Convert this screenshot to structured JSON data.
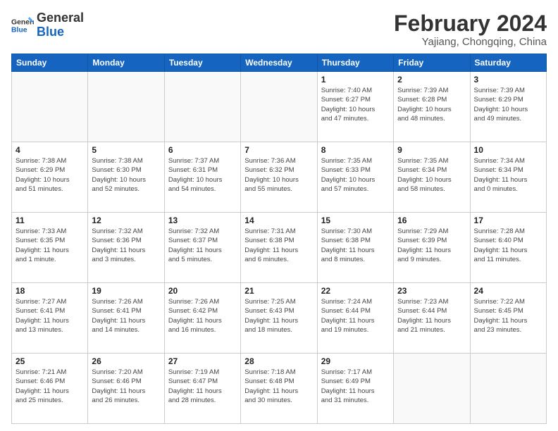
{
  "logo": {
    "line1": "General",
    "line2": "Blue"
  },
  "title": "February 2024",
  "subtitle": "Yajiang, Chongqing, China",
  "days_of_week": [
    "Sunday",
    "Monday",
    "Tuesday",
    "Wednesday",
    "Thursday",
    "Friday",
    "Saturday"
  ],
  "weeks": [
    [
      {
        "day": "",
        "info": ""
      },
      {
        "day": "",
        "info": ""
      },
      {
        "day": "",
        "info": ""
      },
      {
        "day": "",
        "info": ""
      },
      {
        "day": "1",
        "info": "Sunrise: 7:40 AM\nSunset: 6:27 PM\nDaylight: 10 hours\nand 47 minutes."
      },
      {
        "day": "2",
        "info": "Sunrise: 7:39 AM\nSunset: 6:28 PM\nDaylight: 10 hours\nand 48 minutes."
      },
      {
        "day": "3",
        "info": "Sunrise: 7:39 AM\nSunset: 6:29 PM\nDaylight: 10 hours\nand 49 minutes."
      }
    ],
    [
      {
        "day": "4",
        "info": "Sunrise: 7:38 AM\nSunset: 6:29 PM\nDaylight: 10 hours\nand 51 minutes."
      },
      {
        "day": "5",
        "info": "Sunrise: 7:38 AM\nSunset: 6:30 PM\nDaylight: 10 hours\nand 52 minutes."
      },
      {
        "day": "6",
        "info": "Sunrise: 7:37 AM\nSunset: 6:31 PM\nDaylight: 10 hours\nand 54 minutes."
      },
      {
        "day": "7",
        "info": "Sunrise: 7:36 AM\nSunset: 6:32 PM\nDaylight: 10 hours\nand 55 minutes."
      },
      {
        "day": "8",
        "info": "Sunrise: 7:35 AM\nSunset: 6:33 PM\nDaylight: 10 hours\nand 57 minutes."
      },
      {
        "day": "9",
        "info": "Sunrise: 7:35 AM\nSunset: 6:34 PM\nDaylight: 10 hours\nand 58 minutes."
      },
      {
        "day": "10",
        "info": "Sunrise: 7:34 AM\nSunset: 6:34 PM\nDaylight: 11 hours\nand 0 minutes."
      }
    ],
    [
      {
        "day": "11",
        "info": "Sunrise: 7:33 AM\nSunset: 6:35 PM\nDaylight: 11 hours\nand 1 minute."
      },
      {
        "day": "12",
        "info": "Sunrise: 7:32 AM\nSunset: 6:36 PM\nDaylight: 11 hours\nand 3 minutes."
      },
      {
        "day": "13",
        "info": "Sunrise: 7:32 AM\nSunset: 6:37 PM\nDaylight: 11 hours\nand 5 minutes."
      },
      {
        "day": "14",
        "info": "Sunrise: 7:31 AM\nSunset: 6:38 PM\nDaylight: 11 hours\nand 6 minutes."
      },
      {
        "day": "15",
        "info": "Sunrise: 7:30 AM\nSunset: 6:38 PM\nDaylight: 11 hours\nand 8 minutes."
      },
      {
        "day": "16",
        "info": "Sunrise: 7:29 AM\nSunset: 6:39 PM\nDaylight: 11 hours\nand 9 minutes."
      },
      {
        "day": "17",
        "info": "Sunrise: 7:28 AM\nSunset: 6:40 PM\nDaylight: 11 hours\nand 11 minutes."
      }
    ],
    [
      {
        "day": "18",
        "info": "Sunrise: 7:27 AM\nSunset: 6:41 PM\nDaylight: 11 hours\nand 13 minutes."
      },
      {
        "day": "19",
        "info": "Sunrise: 7:26 AM\nSunset: 6:41 PM\nDaylight: 11 hours\nand 14 minutes."
      },
      {
        "day": "20",
        "info": "Sunrise: 7:26 AM\nSunset: 6:42 PM\nDaylight: 11 hours\nand 16 minutes."
      },
      {
        "day": "21",
        "info": "Sunrise: 7:25 AM\nSunset: 6:43 PM\nDaylight: 11 hours\nand 18 minutes."
      },
      {
        "day": "22",
        "info": "Sunrise: 7:24 AM\nSunset: 6:44 PM\nDaylight: 11 hours\nand 19 minutes."
      },
      {
        "day": "23",
        "info": "Sunrise: 7:23 AM\nSunset: 6:44 PM\nDaylight: 11 hours\nand 21 minutes."
      },
      {
        "day": "24",
        "info": "Sunrise: 7:22 AM\nSunset: 6:45 PM\nDaylight: 11 hours\nand 23 minutes."
      }
    ],
    [
      {
        "day": "25",
        "info": "Sunrise: 7:21 AM\nSunset: 6:46 PM\nDaylight: 11 hours\nand 25 minutes."
      },
      {
        "day": "26",
        "info": "Sunrise: 7:20 AM\nSunset: 6:46 PM\nDaylight: 11 hours\nand 26 minutes."
      },
      {
        "day": "27",
        "info": "Sunrise: 7:19 AM\nSunset: 6:47 PM\nDaylight: 11 hours\nand 28 minutes."
      },
      {
        "day": "28",
        "info": "Sunrise: 7:18 AM\nSunset: 6:48 PM\nDaylight: 11 hours\nand 30 minutes."
      },
      {
        "day": "29",
        "info": "Sunrise: 7:17 AM\nSunset: 6:49 PM\nDaylight: 11 hours\nand 31 minutes."
      },
      {
        "day": "",
        "info": ""
      },
      {
        "day": "",
        "info": ""
      }
    ]
  ]
}
